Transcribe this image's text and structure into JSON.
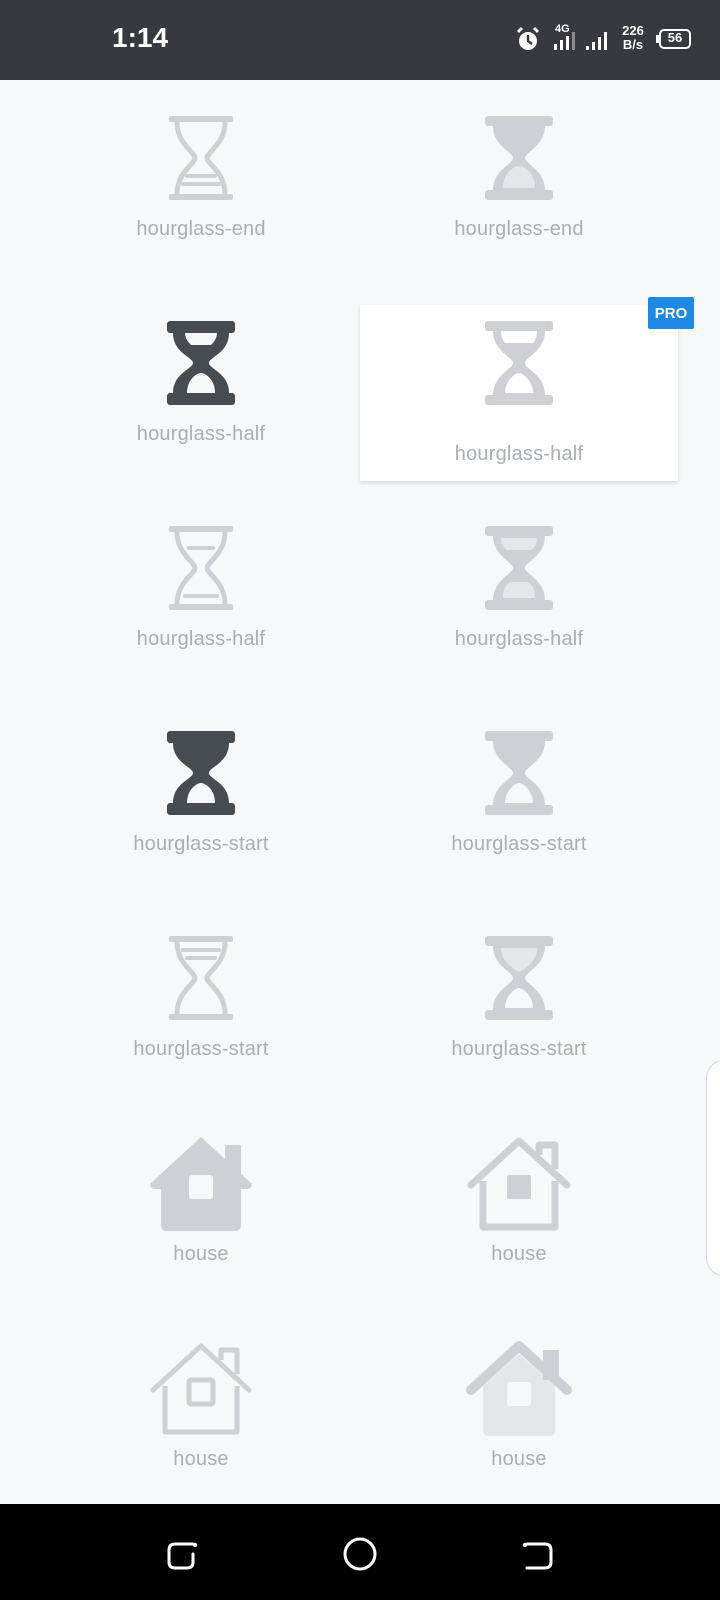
{
  "status_bar": {
    "time": "1:14",
    "network_type": "4G",
    "net_speed_value": "226",
    "net_speed_unit": "B/s",
    "battery": "56",
    "icons": [
      "alarm-icon",
      "signal-icon",
      "signal-icon",
      "battery-icon"
    ]
  },
  "colors": {
    "dark_icon": "#474b52",
    "light_icon": "#cdd1d6",
    "fill_light": "#e4e6e9",
    "pro_badge": "#1e88e5",
    "label": "#a9afb6"
  },
  "grid": {
    "items": [
      {
        "label": "hourglass-end",
        "icon": "hourglass-end-light"
      },
      {
        "label": "hourglass-end",
        "icon": "hourglass-end-duotone"
      },
      {
        "label": "hourglass-half",
        "icon": "hourglass-half-solid"
      },
      {
        "label": "hourglass-half",
        "icon": "hourglass-half-pro",
        "badge": "PRO"
      },
      {
        "label": "hourglass-half",
        "icon": "hourglass-half-light"
      },
      {
        "label": "hourglass-half",
        "icon": "hourglass-half-duotone"
      },
      {
        "label": "hourglass-start",
        "icon": "hourglass-start-solid"
      },
      {
        "label": "hourglass-start",
        "icon": "hourglass-start-regular"
      },
      {
        "label": "hourglass-start",
        "icon": "hourglass-start-light"
      },
      {
        "label": "hourglass-start",
        "icon": "hourglass-start-duotone"
      },
      {
        "label": "house",
        "icon": "house-solid"
      },
      {
        "label": "house",
        "icon": "house-regular"
      },
      {
        "label": "house",
        "icon": "house-light"
      },
      {
        "label": "house",
        "icon": "house-duotone"
      }
    ]
  },
  "nav_bar": {
    "buttons": [
      "recent-apps-button",
      "home-button",
      "back-button"
    ]
  }
}
